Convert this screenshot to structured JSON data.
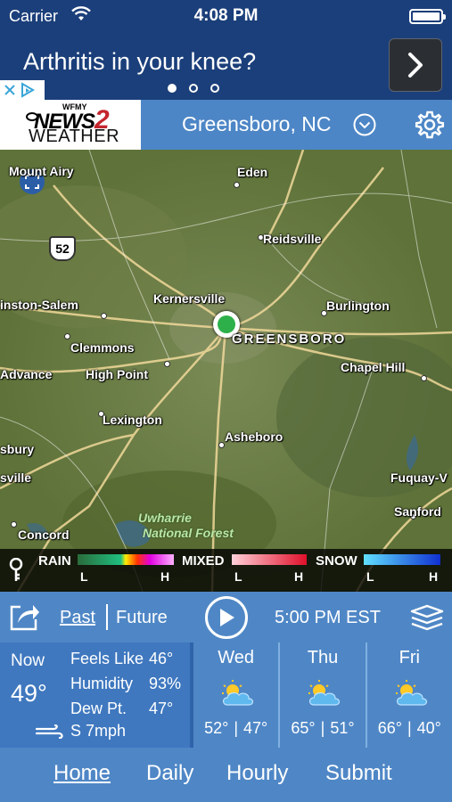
{
  "status_bar": {
    "carrier": "Carrier",
    "time": "4:08 PM"
  },
  "ad": {
    "headline": "Arthritis in your knee?",
    "page_count": 3,
    "active_page": 1
  },
  "header": {
    "logo": {
      "line1": "WFMY",
      "line2": "NEWS",
      "line2_num": "2",
      "line3": "WEATHER"
    },
    "location": "Greensboro, NC"
  },
  "map": {
    "places": {
      "mount_airy": "Mount Airy",
      "eden": "Eden",
      "reidsville": "Reidsville",
      "kernersville": "Kernersville",
      "winston_salem": "inston-Salem",
      "burlington": "Burlington",
      "clemmons": "Clemmons",
      "greensboro": "GREENSBORO",
      "advance": "Advance",
      "high_point": "High Point",
      "chapel_hill": "Chapel Hill",
      "lexington": "Lexington",
      "asheboro": "Asheboro",
      "sbury": "sbury",
      "sville": "sville",
      "fuquay": "Fuquay-V",
      "uwharrie": "Uwharrie",
      "national_forest": "National Forest",
      "sanford": "Sanford",
      "concord": "Concord"
    },
    "route_shield": "52",
    "legend": {
      "rain": "RAIN",
      "mixed": "MIXED",
      "snow": "SNOW",
      "low": "L",
      "high": "H"
    }
  },
  "playback": {
    "past": "Past",
    "future": "Future",
    "forecast_time": "5:00 PM EST"
  },
  "current": {
    "now_label": "Now",
    "temp": "49°",
    "feels_like_label": "Feels Like",
    "feels_like": "46°",
    "humidity_label": "Humidity",
    "humidity": "93%",
    "dew_point_label": "Dew Pt.",
    "dew_point": "47°",
    "wind": "S 7mph"
  },
  "forecast": [
    {
      "day": "Wed",
      "high": "52°",
      "low": "47°",
      "icon": "partly-cloudy-icon"
    },
    {
      "day": "Thu",
      "high": "65°",
      "low": "51°",
      "icon": "partly-cloudy-icon"
    },
    {
      "day": "Fri",
      "high": "66°",
      "low": "40°",
      "icon": "partly-cloudy-icon"
    }
  ],
  "nav": {
    "home": "Home",
    "daily": "Daily",
    "hourly": "Hourly",
    "submit": "Submit"
  },
  "colors": {
    "status_bg": "#1b3f7a",
    "header_bg": "#4d86c6",
    "panel_dark": "#3f78bf",
    "location_marker": "#2db04a",
    "logo_accent": "#c4262e"
  }
}
